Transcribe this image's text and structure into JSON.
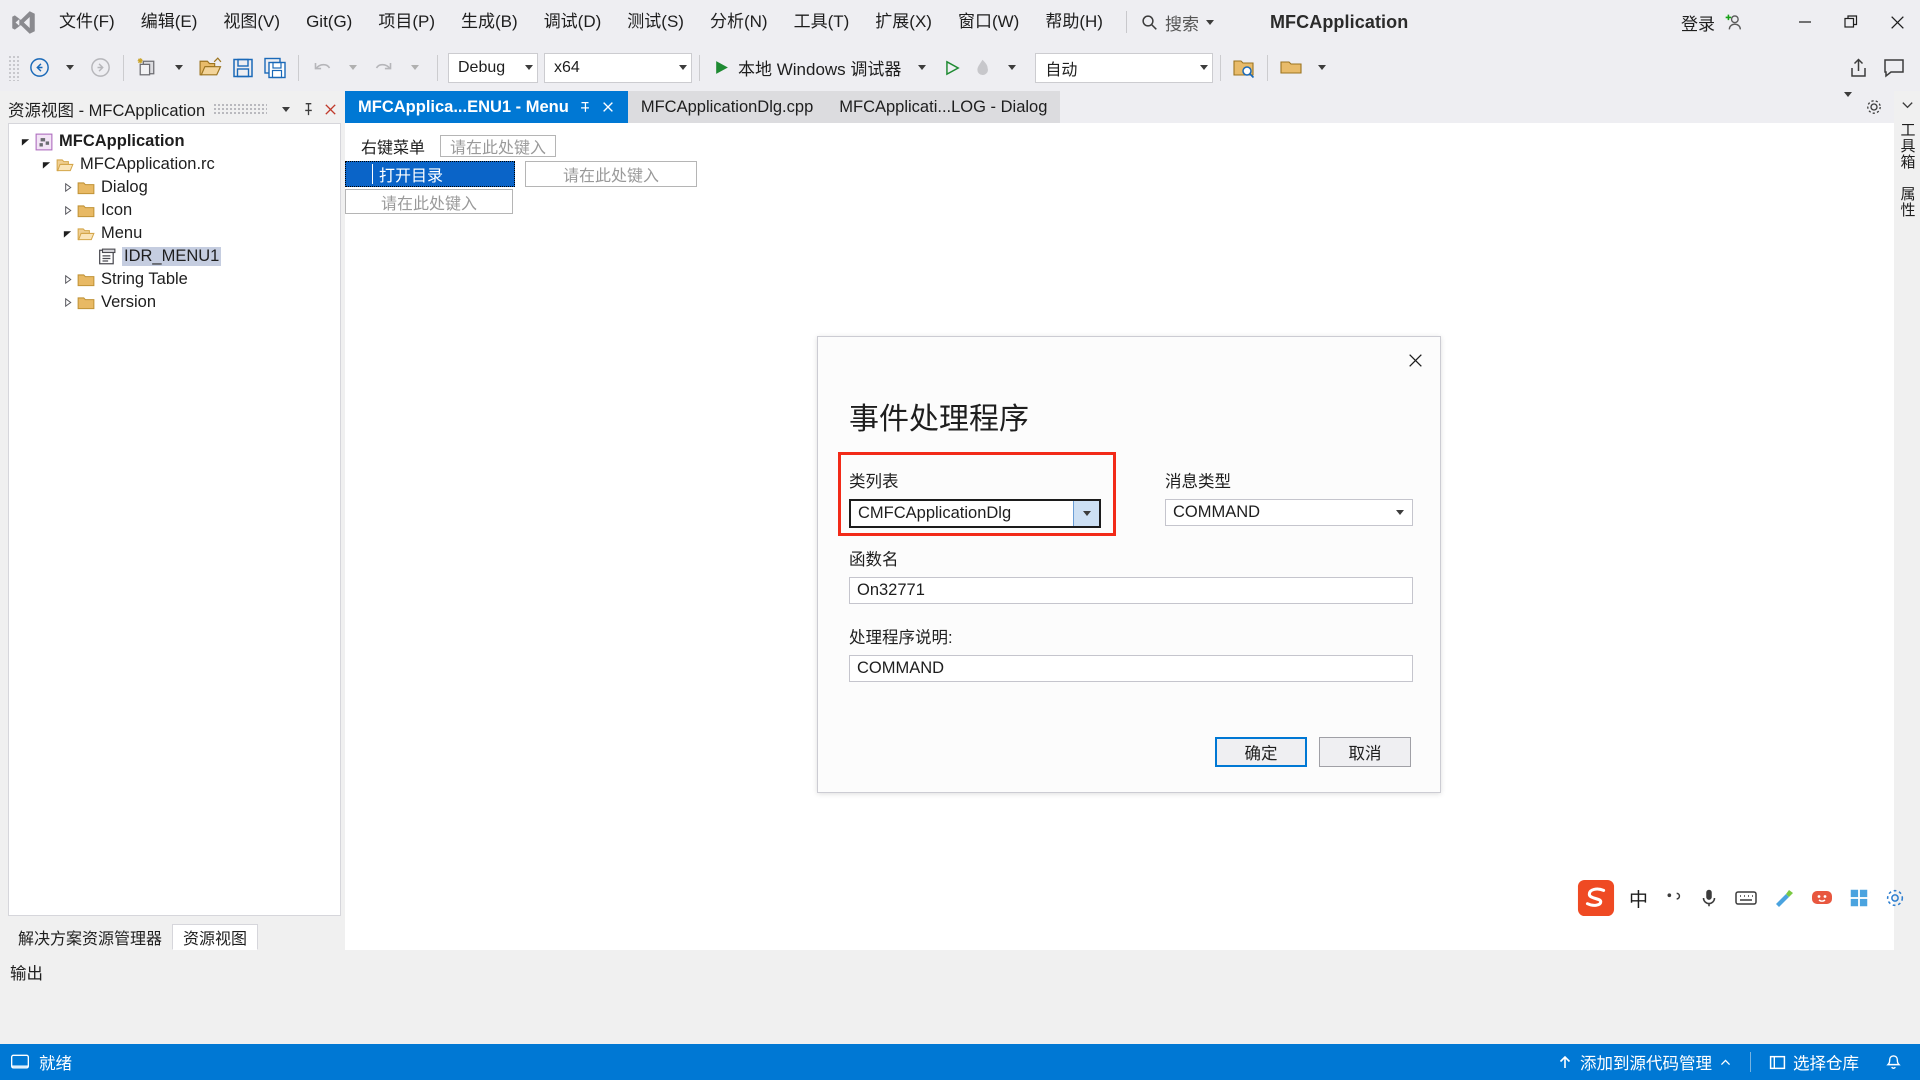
{
  "titlebar": {
    "logo_icon": "visual-studio-logo-icon",
    "menus": [
      {
        "label": "文件(F)"
      },
      {
        "label": "编辑(E)"
      },
      {
        "label": "视图(V)"
      },
      {
        "label": "Git(G)"
      },
      {
        "label": "项目(P)"
      },
      {
        "label": "生成(B)"
      },
      {
        "label": "调试(D)"
      },
      {
        "label": "测试(S)"
      },
      {
        "label": "分析(N)"
      },
      {
        "label": "工具(T)"
      },
      {
        "label": "扩展(X)"
      },
      {
        "label": "窗口(W)"
      },
      {
        "label": "帮助(H)"
      }
    ],
    "search_placeholder": "搜索",
    "search_icon": "search-icon",
    "app_title": "MFCApplication",
    "signin_label": "登录",
    "signin_icon": "add-user-icon",
    "minimize_icon": "minimize-icon",
    "maximize_icon": "restore-icon",
    "close_icon": "close-icon"
  },
  "toolbar": {
    "back_icon": "navigate-back-icon",
    "forward_icon": "navigate-forward-icon",
    "new_item_icon": "new-item-icon",
    "open_icon": "open-file-icon",
    "save_icon": "save-icon",
    "save_all_icon": "save-all-icon",
    "undo_icon": "undo-icon",
    "redo_icon": "redo-icon",
    "configuration": "Debug",
    "platform": "x64",
    "run_label": "本地 Windows 调试器",
    "run_icon": "play-icon",
    "start_no_debug_icon": "play-outline-icon",
    "hot_reload_icon": "hot-reload-icon",
    "auto_select": "自动",
    "find_in_files_icon": "find-in-files-icon",
    "window_layout_icon": "window-layout-icon",
    "share_icon": "share-icon",
    "feedback_icon": "feedback-icon"
  },
  "left_panel": {
    "header": "资源视图 - MFCApplication",
    "dropdown_icon": "chevron-down-icon",
    "pin_icon": "pin-icon",
    "close_icon": "close-icon",
    "tree": [
      {
        "label": "MFCApplication",
        "indent": 0,
        "expander": "expanded",
        "icon": "project-icon",
        "bold": true,
        "selected": false
      },
      {
        "label": "MFCApplication.rc",
        "indent": 1,
        "expander": "expanded",
        "icon": "folder-open-icon",
        "bold": false,
        "selected": false
      },
      {
        "label": "Dialog",
        "indent": 2,
        "expander": "collapsed",
        "icon": "folder-icon",
        "bold": false,
        "selected": false
      },
      {
        "label": "Icon",
        "indent": 2,
        "expander": "collapsed",
        "icon": "folder-icon",
        "bold": false,
        "selected": false
      },
      {
        "label": "Menu",
        "indent": 2,
        "expander": "expanded",
        "icon": "folder-open-icon",
        "bold": false,
        "selected": false
      },
      {
        "label": "IDR_MENU1",
        "indent": 3,
        "expander": "none",
        "icon": "menu-resource-icon",
        "bold": false,
        "selected": true
      },
      {
        "label": "String Table",
        "indent": 2,
        "expander": "collapsed",
        "icon": "folder-icon",
        "bold": false,
        "selected": false
      },
      {
        "label": "Version",
        "indent": 2,
        "expander": "collapsed",
        "icon": "folder-icon",
        "bold": false,
        "selected": false
      }
    ],
    "tabs": [
      {
        "label": "解决方案资源管理器",
        "active": false
      },
      {
        "label": "资源视图",
        "active": true
      }
    ]
  },
  "editor": {
    "tabs": [
      {
        "label": "MFCApplica...ENU1 - Menu",
        "active": true,
        "pin_icon": "pin-icon",
        "close_icon": "close-icon"
      },
      {
        "label": "MFCApplicationDlg.cpp",
        "active": false
      },
      {
        "label": "MFCApplicati...LOG - Dialog",
        "active": false
      }
    ],
    "tabstrip_overflow_icon": "chevron-down-icon",
    "tabstrip_settings_icon": "gear-icon",
    "menu_designer": {
      "top_menu_label": "右键菜单",
      "top_new_placeholder": "请在此处键入",
      "selected_item": "打开目录",
      "new_item_placeholder": "请在此处键入",
      "submenu_placeholder": "请在此处键入"
    }
  },
  "right_rail": [
    {
      "label": "工具箱"
    },
    {
      "label": "属性"
    }
  ],
  "dialog": {
    "title": "事件处理程序",
    "close_icon": "close-icon",
    "class_list_label": "类列表",
    "class_list_value": "CMFCApplicationDlg",
    "class_list_arrow_icon": "chevron-down-icon",
    "message_type_label": "消息类型",
    "message_type_value": "COMMAND",
    "message_type_arrow_icon": "chevron-down-icon",
    "function_name_label": "函数名",
    "function_name_value": "On32771",
    "handler_desc_label": "处理程序说明:",
    "handler_desc_value": "COMMAND",
    "ok_label": "确定",
    "cancel_label": "取消",
    "highlight_color": "#f22a18"
  },
  "ime_bar": {
    "logo_icon": "sogou-logo-icon",
    "mode_label": "中",
    "punctuation_icon": "punctuation-icon",
    "voice_icon": "microphone-icon",
    "keyboard_icon": "keyboard-icon",
    "skin_icon": "skin-icon",
    "emoji_icon": "emoji-icon",
    "apps_icon": "apps-icon",
    "settings_icon": "settings-icon"
  },
  "output": {
    "label": "输出"
  },
  "statusbar": {
    "icon": "status-ready-icon",
    "ready_label": "就绪",
    "source_control_icon": "up-arrow-icon",
    "source_control_label": "添加到源代码管理",
    "source_control_caret_icon": "chevron-up-icon",
    "repo_icon": "repository-icon",
    "repo_label": "选择仓库",
    "notification_icon": "notification-icon",
    "accent_color": "#0078d4"
  }
}
